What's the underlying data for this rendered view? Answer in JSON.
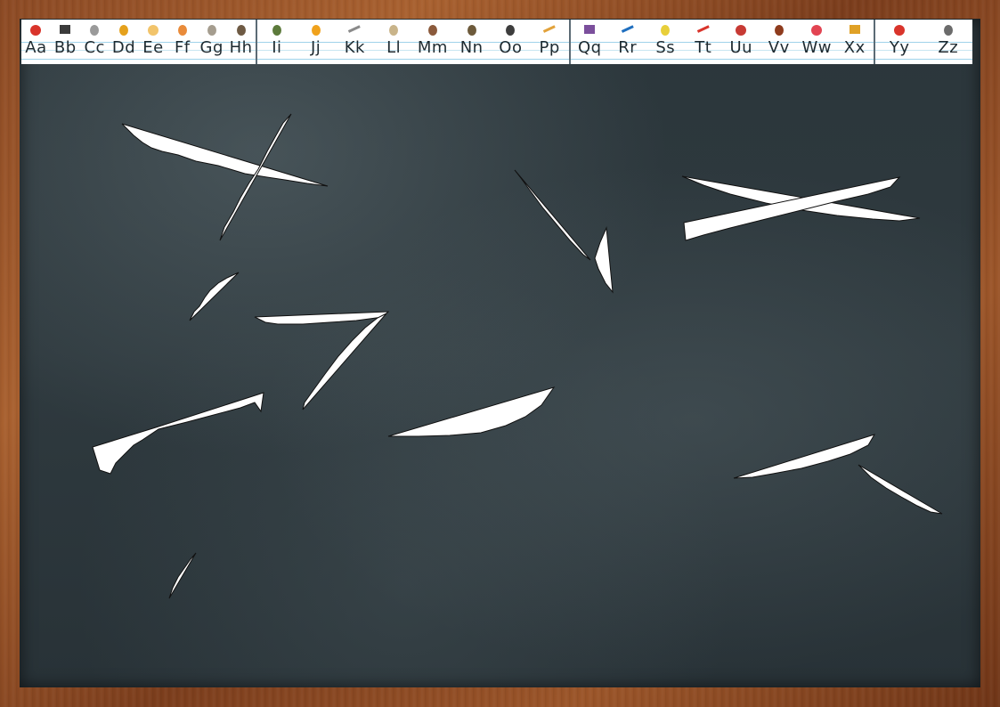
{
  "alphabet": [
    {
      "label": "Aa",
      "icon": "apple-icon",
      "color": "#d9342b"
    },
    {
      "label": "Bb",
      "icon": "book-icon",
      "color": "#3b3b3b"
    },
    {
      "label": "Cc",
      "icon": "cat-icon",
      "color": "#9a9a9a"
    },
    {
      "label": "Dd",
      "icon": "duck-icon",
      "color": "#e5a11c"
    },
    {
      "label": "Ee",
      "icon": "eggs-icon",
      "color": "#f2c46b"
    },
    {
      "label": "Ff",
      "icon": "fish-bowl-icon",
      "color": "#e98b3a"
    },
    {
      "label": "Gg",
      "icon": "goat-icon",
      "color": "#a59d8f"
    },
    {
      "label": "Hh",
      "icon": "horse-icon",
      "color": "#6e5a44"
    },
    {
      "label": "Ii",
      "icon": "insect-icon",
      "color": "#5c7a3b"
    },
    {
      "label": "Jj",
      "icon": "jacket-icon",
      "color": "#f0a21d"
    },
    {
      "label": "Kk",
      "icon": "key-icon",
      "color": "#8a8a8a"
    },
    {
      "label": "Ll",
      "icon": "lamp-icon",
      "color": "#c9b48a"
    },
    {
      "label": "Mm",
      "icon": "magnifier-icon",
      "color": "#8b5a3c"
    },
    {
      "label": "Nn",
      "icon": "nest-icon",
      "color": "#6d5a3b"
    },
    {
      "label": "Oo",
      "icon": "ostrich-icon",
      "color": "#3d3d3d"
    },
    {
      "label": "Pp",
      "icon": "pencils-icon",
      "color": "#e2a23b"
    },
    {
      "label": "Qq",
      "icon": "quilt-icon",
      "color": "#7b4f9c"
    },
    {
      "label": "Rr",
      "icon": "ruler-icon",
      "color": "#1f6fbf"
    },
    {
      "label": "Ss",
      "icon": "slippers-icon",
      "color": "#e8cf3a"
    },
    {
      "label": "Tt",
      "icon": "toothbrush-icon",
      "color": "#d9342b"
    },
    {
      "label": "Uu",
      "icon": "umbrella-icon",
      "color": "#c73a34"
    },
    {
      "label": "Vv",
      "icon": "violin-icon",
      "color": "#8e3b1d"
    },
    {
      "label": "Ww",
      "icon": "watermelon-icon",
      "color": "#e24452"
    },
    {
      "label": "Xx",
      "icon": "xylophone-icon",
      "color": "#e0a126"
    },
    {
      "label": "Yy",
      "icon": "yoyo-icon",
      "color": "#d9342b"
    },
    {
      "label": "Zz",
      "icon": "zebra-icon",
      "color": "#6b6b6b"
    }
  ],
  "segments": [
    [
      0,
      8
    ],
    [
      8,
      16
    ],
    [
      16,
      24
    ],
    [
      24,
      26
    ]
  ],
  "colors": {
    "board": "#2c373c",
    "frame": "#8c4a24",
    "chalk": "#ffffff"
  }
}
